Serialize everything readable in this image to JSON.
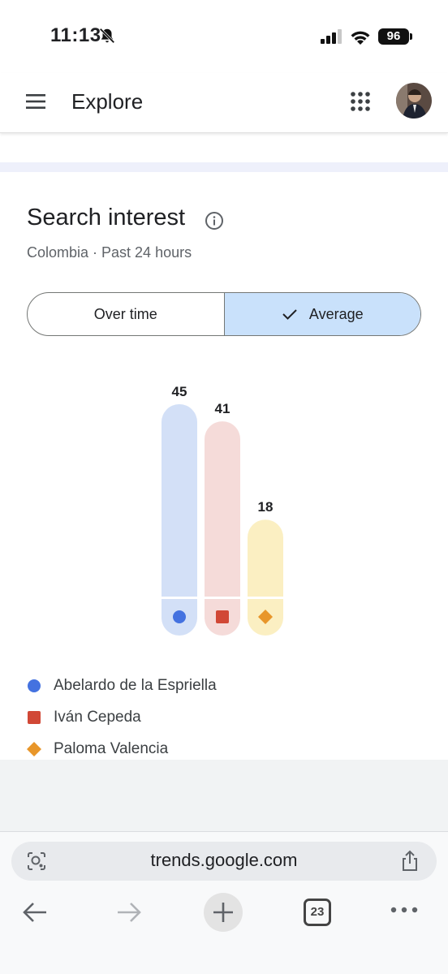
{
  "status_bar": {
    "time": "11:13",
    "battery": "96",
    "icons": [
      "bell-off-icon",
      "signal-icon",
      "wifi-icon",
      "battery-icon"
    ]
  },
  "app_bar": {
    "title": "Explore",
    "icons": [
      "menu-icon",
      "apps-grid-icon",
      "avatar"
    ]
  },
  "card": {
    "title": "Search interest",
    "subtitle": "Colombia · Past 24 hours",
    "toggle": {
      "over_time_label": "Over time",
      "average_label": "Average",
      "selected": "Average"
    }
  },
  "chart_data": {
    "type": "bar",
    "series": [
      {
        "name": "Abelardo de la Espriella",
        "value": 45,
        "color": "#4472e0",
        "bar_color": "#d3e0f7",
        "marker": "circle"
      },
      {
        "name": "Iván Cepeda",
        "value": 41,
        "color": "#d14836",
        "bar_color": "#f5dbd9",
        "marker": "square"
      },
      {
        "name": "Paloma Valencia",
        "value": 18,
        "color": "#e8962a",
        "bar_color": "#fbefc2",
        "marker": "diamond"
      }
    ],
    "values": [
      45,
      41,
      18
    ],
    "ylim": [
      0,
      45
    ]
  },
  "browser": {
    "url": "trends.google.com",
    "tab_count": "23",
    "icons": [
      "lens-icon",
      "share-icon",
      "back-arrow-icon",
      "forward-arrow-icon",
      "new-tab-icon",
      "tabs-icon",
      "more-icon"
    ]
  },
  "colors": {
    "selected_toggle": "#c9e1fb",
    "lavender_strip": "#eef0fb"
  }
}
